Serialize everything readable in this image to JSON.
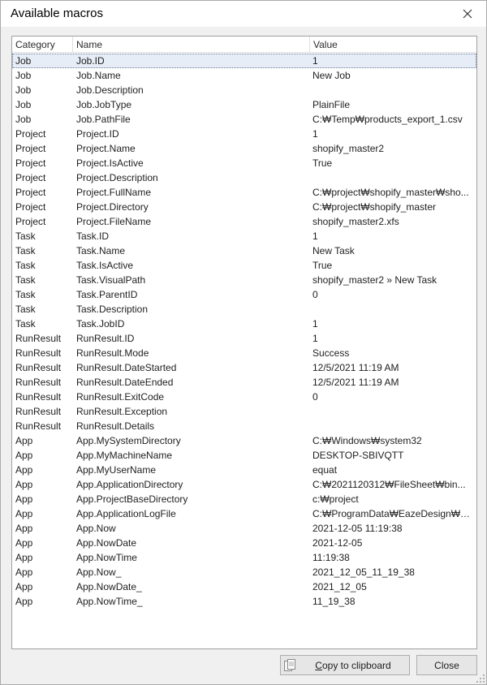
{
  "window": {
    "title": "Available macros"
  },
  "columns": {
    "category": "Category",
    "name": "Name",
    "value": "Value"
  },
  "rows": [
    {
      "category": "Job",
      "name": "Job.ID",
      "value": "1"
    },
    {
      "category": "Job",
      "name": "Job.Name",
      "value": "New Job"
    },
    {
      "category": "Job",
      "name": "Job.Description",
      "value": ""
    },
    {
      "category": "Job",
      "name": "Job.JobType",
      "value": "PlainFile"
    },
    {
      "category": "Job",
      "name": "Job.PathFile",
      "value": "C:₩Temp₩products_export_1.csv"
    },
    {
      "category": "Project",
      "name": "Project.ID",
      "value": "1"
    },
    {
      "category": "Project",
      "name": "Project.Name",
      "value": "shopify_master2"
    },
    {
      "category": "Project",
      "name": "Project.IsActive",
      "value": "True"
    },
    {
      "category": "Project",
      "name": "Project.Description",
      "value": ""
    },
    {
      "category": "Project",
      "name": "Project.FullName",
      "value": "C:₩project₩shopify_master₩sho..."
    },
    {
      "category": "Project",
      "name": "Project.Directory",
      "value": "C:₩project₩shopify_master"
    },
    {
      "category": "Project",
      "name": "Project.FileName",
      "value": "shopify_master2.xfs"
    },
    {
      "category": "Task",
      "name": "Task.ID",
      "value": "1"
    },
    {
      "category": "Task",
      "name": "Task.Name",
      "value": "New Task"
    },
    {
      "category": "Task",
      "name": "Task.IsActive",
      "value": "True"
    },
    {
      "category": "Task",
      "name": "Task.VisualPath",
      "value": "shopify_master2  »  New Task"
    },
    {
      "category": "Task",
      "name": "Task.ParentID",
      "value": "0"
    },
    {
      "category": "Task",
      "name": "Task.Description",
      "value": ""
    },
    {
      "category": "Task",
      "name": "Task.JobID",
      "value": "1"
    },
    {
      "category": "RunResult",
      "name": "RunResult.ID",
      "value": "1"
    },
    {
      "category": "RunResult",
      "name": "RunResult.Mode",
      "value": "Success"
    },
    {
      "category": "RunResult",
      "name": "RunResult.DateStarted",
      "value": "12/5/2021 11:19 AM"
    },
    {
      "category": "RunResult",
      "name": "RunResult.DateEnded",
      "value": "12/5/2021 11:19 AM"
    },
    {
      "category": "RunResult",
      "name": "RunResult.ExitCode",
      "value": "0"
    },
    {
      "category": "RunResult",
      "name": "RunResult.Exception",
      "value": ""
    },
    {
      "category": "RunResult",
      "name": "RunResult.Details",
      "value": ""
    },
    {
      "category": "App",
      "name": "App.MySystemDirectory",
      "value": "C:₩Windows₩system32"
    },
    {
      "category": "App",
      "name": "App.MyMachineName",
      "value": "DESKTOP-SBIVQTT"
    },
    {
      "category": "App",
      "name": "App.MyUserName",
      "value": "equat"
    },
    {
      "category": "App",
      "name": "App.ApplicationDirectory",
      "value": "C:₩2021120312₩FileSheet₩bin..."
    },
    {
      "category": "App",
      "name": "App.ProjectBaseDirectory",
      "value": "c:₩project"
    },
    {
      "category": "App",
      "name": "App.ApplicationLogFile",
      "value": "C:₩ProgramData₩EazeDesign₩Fil..."
    },
    {
      "category": "App",
      "name": "App.Now",
      "value": "2021-12-05 11:19:38"
    },
    {
      "category": "App",
      "name": "App.NowDate",
      "value": "2021-12-05"
    },
    {
      "category": "App",
      "name": "App.NowTime",
      "value": "11:19:38"
    },
    {
      "category": "App",
      "name": "App.Now_",
      "value": "2021_12_05_11_19_38"
    },
    {
      "category": "App",
      "name": "App.NowDate_",
      "value": "2021_12_05"
    },
    {
      "category": "App",
      "name": "App.NowTime_",
      "value": "11_19_38"
    }
  ],
  "selected_row": 0,
  "buttons": {
    "copy_label_underlined": "C",
    "copy_label_rest": "opy to clipboard",
    "close_label": "Close"
  },
  "icons": {
    "close": "close-icon",
    "copy": "clipboard-icon",
    "grip": "resize-grip-icon"
  },
  "colors": {
    "selection_bg": "#e6edf7",
    "border": "#a0a0a0"
  }
}
